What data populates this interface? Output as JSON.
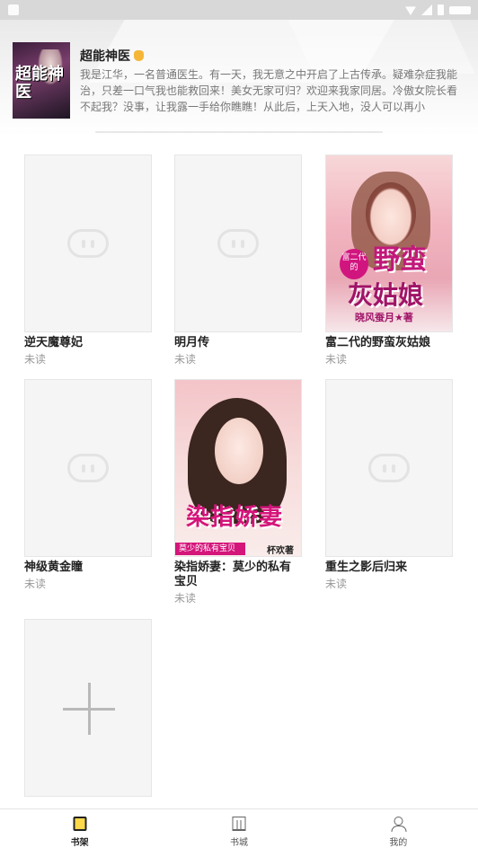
{
  "featured": {
    "title": "超能神医",
    "cover_text": "超能神医",
    "description": "我是江华，一名普通医生。有一天，我无意之中开启了上古传承。疑难杂症我能治，只差一口气我也能救回来！美女无家可归？欢迎来我家同居。冷傲女院长看不起我？没事，让我露一手给你瞧瞧！从此后，上天入地，没人可以再小"
  },
  "books": [
    {
      "title": "逆天魔尊妃",
      "status": "未读",
      "cover": "placeholder"
    },
    {
      "title": "明月传",
      "status": "未读",
      "cover": "placeholder"
    },
    {
      "title": "富二代的野蛮灰姑娘",
      "status": "未读",
      "cover": "art",
      "cover_title_1": "野蛮",
      "cover_title_2": "灰姑娘",
      "cover_tag": "富二代的",
      "cover_author": "晓风蚕月★著"
    },
    {
      "title": "神级黄金瞳",
      "status": "未读",
      "cover": "placeholder"
    },
    {
      "title": "染指娇妻：莫少的私有宝贝",
      "status": "未读",
      "cover": "art",
      "cover_title_1": "染指娇妻",
      "cover_band": "莫少的私有宝贝",
      "cover_author": "杯欢著"
    },
    {
      "title": "重生之影后归来",
      "status": "未读",
      "cover": "placeholder"
    }
  ],
  "bottom_nav": [
    {
      "label": "书架",
      "icon": "bookshelf-icon",
      "active": true
    },
    {
      "label": "书城",
      "icon": "bookstore-icon",
      "active": false
    },
    {
      "label": "我的",
      "icon": "profile-icon",
      "active": false
    }
  ],
  "colors": {
    "accent_yellow": "#ffd84a",
    "cover_pink": "#d4157a",
    "muted_text": "#999999"
  }
}
